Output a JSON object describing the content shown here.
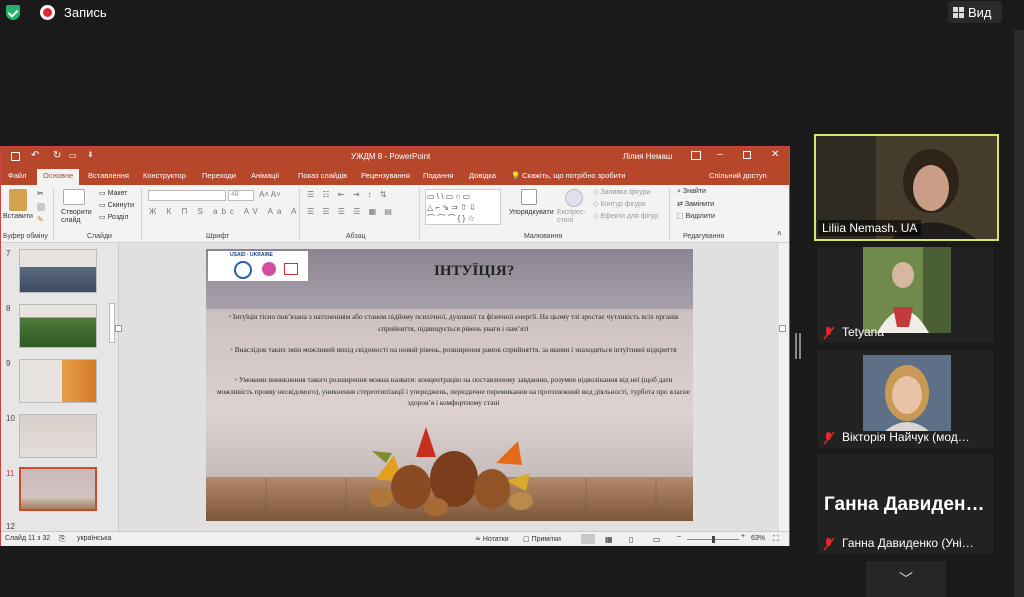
{
  "zoom": {
    "record_label": "Запись",
    "view_label": "Вид"
  },
  "ppt": {
    "doc_title": "УЖДМ 8  -  PowerPoint",
    "user_name": "Лілия Немаш",
    "tabs": [
      "Файл",
      "Основне",
      "Вставлення",
      "Конструктор",
      "Переходи",
      "Анімації",
      "Показ слайдів",
      "Рецензування",
      "Подання",
      "Довідка"
    ],
    "tell_me": "Скажіть, що потрібно зробити",
    "share": "Спільний доступ",
    "ribbon": {
      "paste": "Вставити",
      "clipboard": "Буфер обміну",
      "new_slide": "Створити слайд",
      "layout": "Макет",
      "reset": "Скинути",
      "section": "Розділ",
      "slides": "Слайди",
      "font_size": "48",
      "font": "Шрифт",
      "paragraph": "Абзац",
      "arrange": "Упорядкувати",
      "quick_styles": "Експрес-стилі",
      "shape_fill": "Заливка фігури",
      "shape_outline": "Контур фігури",
      "shape_effects": "Ефекти для фігур",
      "drawing": "Малювання",
      "find": "Знайти",
      "replace": "Замінити",
      "select": "Виділити",
      "editing": "Редагування"
    },
    "thumb_numbers": [
      "7",
      "8",
      "9",
      "10",
      "11",
      "12"
    ],
    "status": {
      "slide_of": "Слайд 11 з 32",
      "language": "українська",
      "notes": "Нотатки",
      "comments": "Примітки",
      "zoom": "63%"
    },
    "slide": {
      "logo_text": "USAID · UKRAINE",
      "title": "ІНТУЇЦІЯ?",
      "bullets": [
        "Інтуїція тісно пов’язана з натхненням або станом підйому психічної, духовної та фізичної енергії. На цьому тлі зростає чутливість всіх органів сприйняття, підвищується рівень уваги і пам’яті",
        "Внаслідок таких змін можливий вихід свідомості на новий рівень, розширення рамок сприйняття, за якими і знаходяться інтуїтивні відкриття",
        "Умовами виникнення такого розширення можна назвати: концентрацію на поставленому завданню, розумне відволікання від неї (щоб дати можливість прояву несвідомого), уникнення стереотипізації і упереджень, періодичне перемикання на протилежний вид діяльності, турбота про власне здоров’я і комфортному стані"
      ]
    }
  },
  "participants": [
    {
      "name": "Liliia Nemash. UA"
    },
    {
      "name": "Tetyana"
    },
    {
      "name": "Вікторія Найчук (мод…"
    },
    {
      "name": "Ганна Давиденко (Уні…",
      "big_label": "Ганна  Давиден…"
    }
  ],
  "colors": {
    "ppt_accent": "#b7472a",
    "active_speaker_border": "#d7e36a",
    "mic_muted": "#e0282e"
  }
}
